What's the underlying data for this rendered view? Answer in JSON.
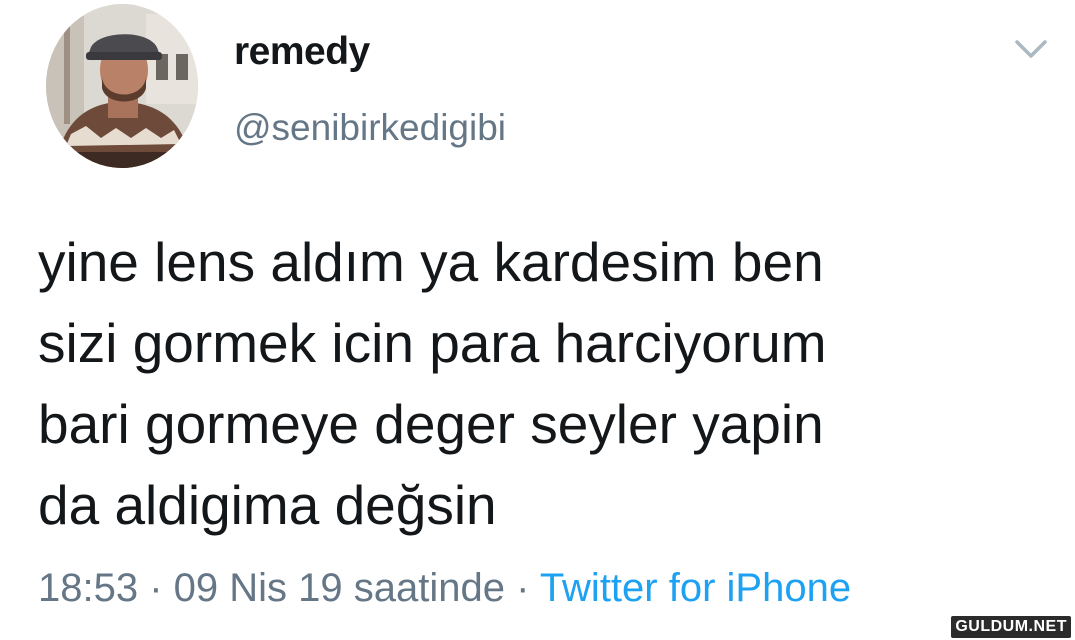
{
  "tweet": {
    "author": {
      "display_name": "remedy",
      "handle": "@senibirkedigibi"
    },
    "text_lines": [
      "yine lens aldım ya kardesim ben",
      "sizi gormek icin para harciyorum",
      "bari gormeye deger seyler yapin",
      "da aldigima değsin"
    ],
    "time": "18:53",
    "separator": " · ",
    "date_text": "09 Nis 19 saatinde",
    "source": "Twitter for iPhone"
  },
  "menu_icon": "chevron-down-icon",
  "watermark": "GULDUM.NET",
  "colors": {
    "text": "#14171a",
    "secondary": "#657786",
    "link": "#1da1f2",
    "background": "#ffffff"
  }
}
